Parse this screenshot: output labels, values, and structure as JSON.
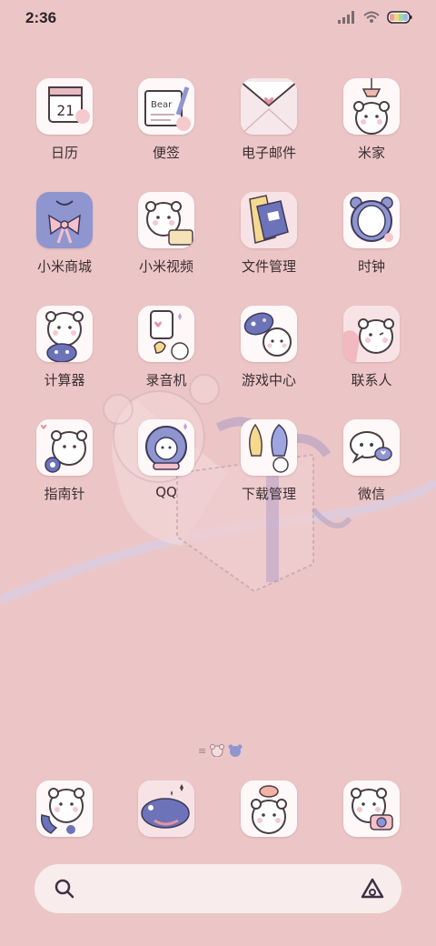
{
  "status_bar": {
    "time": "2:36",
    "icons": [
      "signal-icon",
      "wifi-icon",
      "battery-icon"
    ]
  },
  "home_apps": [
    {
      "label": "日历",
      "icon": "calendar-icon",
      "calendar_date": "21"
    },
    {
      "label": "便签",
      "icon": "notes-icon",
      "note_text": "Bear"
    },
    {
      "label": "电子邮件",
      "icon": "email-icon"
    },
    {
      "label": "米家",
      "icon": "mijia-icon"
    },
    {
      "label": "小米商城",
      "icon": "mall-icon"
    },
    {
      "label": "小米视频",
      "icon": "video-icon"
    },
    {
      "label": "文件管理",
      "icon": "files-icon"
    },
    {
      "label": "时钟",
      "icon": "clock-icon"
    },
    {
      "label": "计算器",
      "icon": "calculator-icon"
    },
    {
      "label": "录音机",
      "icon": "recorder-icon"
    },
    {
      "label": "游戏中心",
      "icon": "game-center-icon"
    },
    {
      "label": "联系人",
      "icon": "contacts-icon"
    },
    {
      "label": "指南针",
      "icon": "compass-icon"
    },
    {
      "label": "QQ",
      "icon": "qq-icon"
    },
    {
      "label": "下载管理",
      "icon": "download-icon"
    },
    {
      "label": "微信",
      "icon": "wechat-icon"
    }
  ],
  "dock_apps": [
    {
      "icon": "phone-icon"
    },
    {
      "icon": "messages-icon"
    },
    {
      "icon": "browser-icon"
    },
    {
      "icon": "camera-icon"
    }
  ],
  "page_indicator": {
    "icons": [
      "menu-lines-icon",
      "bear-face-icon",
      "bear-face-active-icon"
    ]
  },
  "search": {
    "icons": [
      "search-icon",
      "assistant-icon"
    ]
  },
  "colors": {
    "background": "#ecc6c6",
    "accent_purple": "#8f95cf",
    "icon_tile": "#fff8f8"
  }
}
